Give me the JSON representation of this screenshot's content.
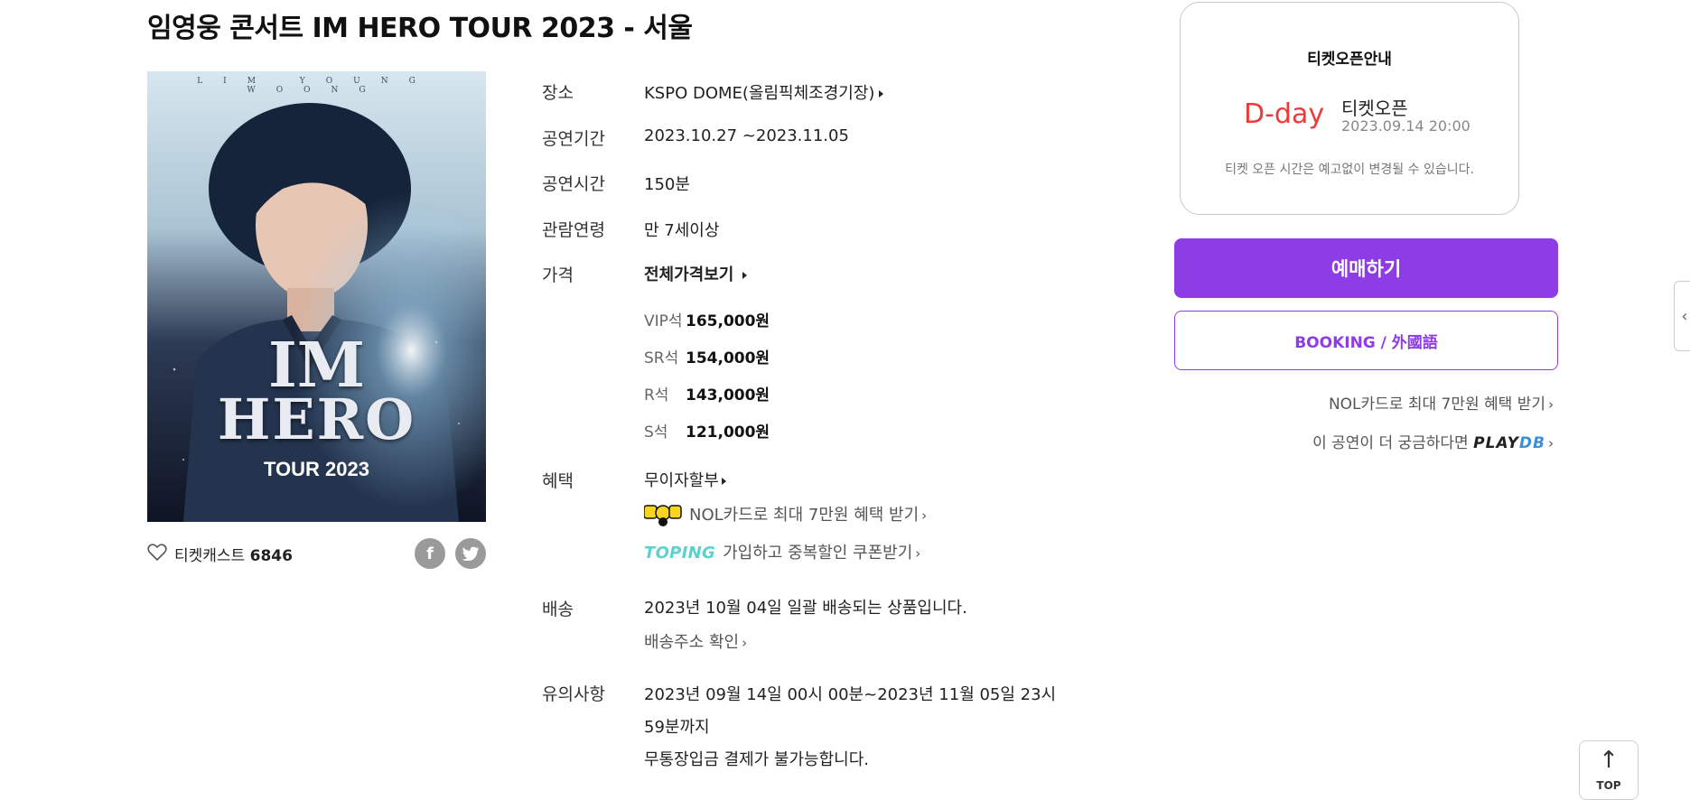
{
  "title": "임영웅 콘서트 IM HERO TOUR 2023 - 서울",
  "poster": {
    "top_text": "LIM YOUNG WOONG",
    "logo_line1": "IM",
    "logo_line2": "HERO",
    "tour": "TOUR 2023"
  },
  "ticketcast": {
    "label": "티켓캐스트",
    "count": "6846"
  },
  "share": {
    "facebook": "f",
    "twitter": "t"
  },
  "info": {
    "venue_label": "장소",
    "venue": "KSPO DOME(올림픽체조경기장)",
    "period_label": "공연기간",
    "period": "2023.10.27 ~2023.11.05",
    "runtime_label": "공연시간",
    "runtime": "150분",
    "age_label": "관람연령",
    "age": "만 7세이상",
    "price_label": "가격",
    "price_all": "전체가격보기",
    "seats": [
      {
        "name": "VIP석",
        "price": "165,000원"
      },
      {
        "name": "SR석",
        "price": "154,000원"
      },
      {
        "name": "R석",
        "price": "143,000원"
      },
      {
        "name": "S석",
        "price": "121,000원"
      }
    ],
    "benefit_label": "혜택",
    "benefit_installment": "무이자할부",
    "benefit_nol": "NOL카드로 최대 7만원 혜택 받기",
    "benefit_toping_logo": "TOPING",
    "benefit_toping": "가입하고 중복할인 쿠폰받기",
    "delivery_label": "배송",
    "delivery": "2023년 10월 04일 일괄 배송되는 상품입니다.",
    "delivery_check": "배송주소 확인",
    "notice_label": "유의사항",
    "notice_line1": "2023년 09월 14일 00시 00분~2023년 11월 05일 23시",
    "notice_line2": "59분까지",
    "notice_line3": "무통장입금 결제가 불가능합니다."
  },
  "ticket_open": {
    "title": "티켓오픈안내",
    "dday": "D-day",
    "label": "티켓오픈",
    "date": "2023.09.14 20:00",
    "note": "티켓 오픈 시간은 예고없이 변경될 수 있습니다."
  },
  "buttons": {
    "book": "예매하기",
    "foreign": "BOOKING / 外國語"
  },
  "links": {
    "nol": "NOL카드로 최대 7만원 혜택 받기",
    "playdb_prefix": "이 공연이 더 궁금하다면",
    "playdb_play": "PLAY",
    "playdb_db": "DB"
  },
  "side_tab": "‹",
  "top_button": {
    "arrow": "↑",
    "label": "TOP"
  },
  "colors": {
    "accent": "#8e3de6",
    "dday": "#ec3b3b",
    "toping": "#5fd1cc",
    "playdb_db": "#3a8fd8"
  }
}
